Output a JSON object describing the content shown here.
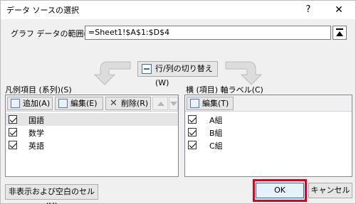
{
  "window": {
    "title": "データ ソースの選択",
    "help_label": "?",
    "close_label": "✕"
  },
  "range": {
    "label": "グラフ データの範囲(D):",
    "value": "=Sheet1!$A$1:$D$4",
    "collapse_icon": "collapse-dialog-icon"
  },
  "switch_button": {
    "label": "行/列の切り替え(W)"
  },
  "series_panel": {
    "label": "凡例項目 (系列)(S)",
    "add_label": "追加(A)",
    "edit_label": "編集(E)",
    "delete_label": "削除(R)",
    "items": [
      {
        "label": "国語",
        "checked": true,
        "selected": true
      },
      {
        "label": "数学",
        "checked": true,
        "selected": false
      },
      {
        "label": "英語",
        "checked": true,
        "selected": false
      }
    ]
  },
  "axis_panel": {
    "label": "横 (項目) 軸ラベル(C)",
    "edit_label": "編集(T)",
    "items": [
      {
        "label": "A組",
        "checked": true
      },
      {
        "label": "B組",
        "checked": true
      },
      {
        "label": "C組",
        "checked": true
      }
    ]
  },
  "footer": {
    "hidden_cells_label": "非表示および空白のセル(H)",
    "ok_label": "OK",
    "cancel_label": "キャンセル"
  },
  "colors": {
    "highlight": "#e4001b",
    "accent": "#0078d7"
  }
}
